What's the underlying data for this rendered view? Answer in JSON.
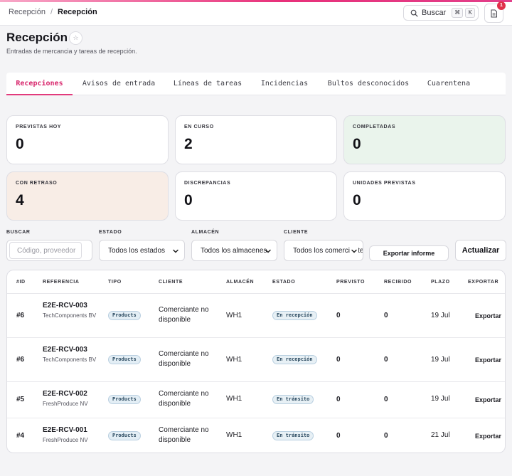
{
  "header": {
    "breadcrumb": [
      "Recepción",
      "Recepción"
    ],
    "breadcrumb_separator": "/",
    "search_label": "Buscar",
    "shortcut_keys": [
      "⌘",
      "K"
    ],
    "notification_count": "1"
  },
  "page": {
    "title": "Recepción",
    "subtitle": "Entradas de mercancia y tareas de recepción."
  },
  "tabs": [
    {
      "label": "Recepciones",
      "active": true
    },
    {
      "label": "Avisos de entrada",
      "active": false
    },
    {
      "label": "Líneas de tareas",
      "active": false
    },
    {
      "label": "Incidencias",
      "active": false
    },
    {
      "label": "Bultos desconocidos",
      "active": false
    },
    {
      "label": "Cuarentena",
      "active": false
    }
  ],
  "stats": [
    {
      "label": "PREVISTAS HOY",
      "value": "0"
    },
    {
      "label": "EN CURSO",
      "value": "2"
    },
    {
      "label": "COMPLETADAS",
      "value": "0"
    },
    {
      "label": "CON RETRASO",
      "value": "4"
    },
    {
      "label": "DISCREPANCIAS",
      "value": "0"
    },
    {
      "label": "UNIDADES PREVISTAS",
      "value": "0"
    }
  ],
  "filters": {
    "search": {
      "label": "BUSCAR",
      "placeholder": "Código, proveedor"
    },
    "estado": {
      "label": "ESTADO",
      "value": "Todos los estados"
    },
    "almacen": {
      "label": "ALMACÉN",
      "value": "Todos los almacenes"
    },
    "cliente": {
      "label": "CLIENTE",
      "value": "Todos los comerciantes"
    },
    "export_label": "Exportar informe",
    "refresh_label": "Actualizar"
  },
  "table": {
    "columns": [
      "#ID",
      "REFERENCIA",
      "TIPO",
      "CLIENTE",
      "ALMACÉN",
      "ESTADO",
      "PREVISTO",
      "RECIBIDO",
      "PLAZO",
      "EXPORTAR"
    ],
    "rows": [
      {
        "id": "#6",
        "ref": "E2E-RCV-003",
        "supplier": "TechComponents BV",
        "type": "Products",
        "client": "Comerciante no disponible",
        "warehouse": "WH1",
        "status": "En recepción",
        "expected": "0",
        "received": "0",
        "deadline": "19 Jul",
        "export": "Exportar"
      },
      {
        "id": "#6",
        "ref": "E2E-RCV-003",
        "supplier": "TechComponents BV",
        "type": "Products",
        "client": "Comerciante no disponible",
        "warehouse": "WH1",
        "status": "En recepción",
        "expected": "0",
        "received": "0",
        "deadline": "19 Jul",
        "export": "Exportar"
      },
      {
        "id": "#5",
        "ref": "E2E-RCV-002",
        "supplier": "FreshProduce NV",
        "type": "Products",
        "client": "Comerciante no disponible",
        "warehouse": "WH1",
        "status": "En tránsito",
        "expected": "0",
        "received": "0",
        "deadline": "19 Jul",
        "export": "Exportar"
      },
      {
        "id": "#4",
        "ref": "E2E-RCV-001",
        "supplier": "FreshProduce NV",
        "type": "Products",
        "client": "Comerciante no disponible",
        "warehouse": "WH1",
        "status": "En tránsito",
        "expected": "0",
        "received": "0",
        "deadline": "21 Jul",
        "export": "Exportar"
      }
    ]
  },
  "colors": {
    "accent": "#e23a7c",
    "completed_card": "#eaf4ec",
    "delayed_card": "#f8ede6"
  }
}
